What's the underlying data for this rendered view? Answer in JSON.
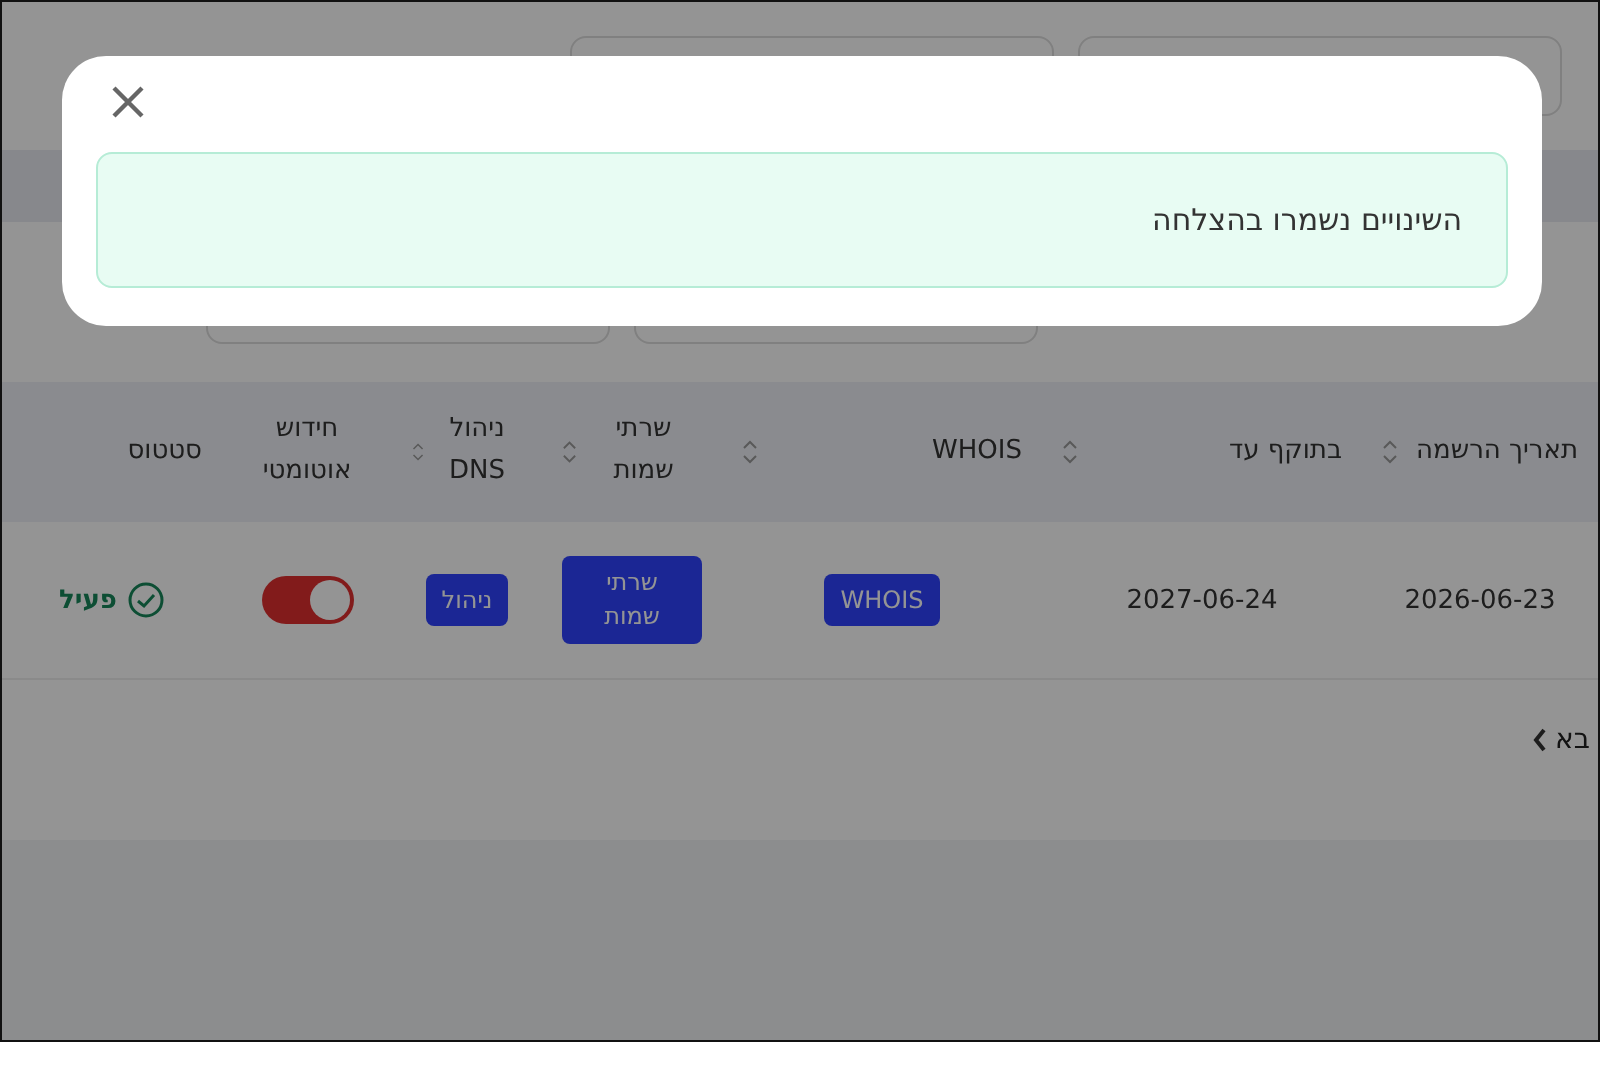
{
  "table": {
    "columns": [
      {
        "label": "תאריך הרשמה",
        "sortable": true
      },
      {
        "label": "בתוקף עד",
        "sortable": true
      },
      {
        "label": "WHOIS",
        "sortable": true
      },
      {
        "label": "שרתי שמות",
        "sortable": true
      },
      {
        "label": "ניהול DNS",
        "sortable": true
      },
      {
        "label": "חידוש אוטומטי",
        "sortable": false
      },
      {
        "label": "סטטוס",
        "sortable": false
      }
    ],
    "rows": [
      {
        "registered": "2026-06-23",
        "expires": "2027-06-24",
        "whois_button": "WHOIS",
        "nameservers_button": "שרתי שמות",
        "dns_button": "ניהול",
        "auto_renew": {
          "on": true
        },
        "status": "פעיל"
      }
    ]
  },
  "pagination": {
    "next": "בא"
  },
  "modal": {
    "message": "השינויים נשמרו בהצלחה"
  }
}
